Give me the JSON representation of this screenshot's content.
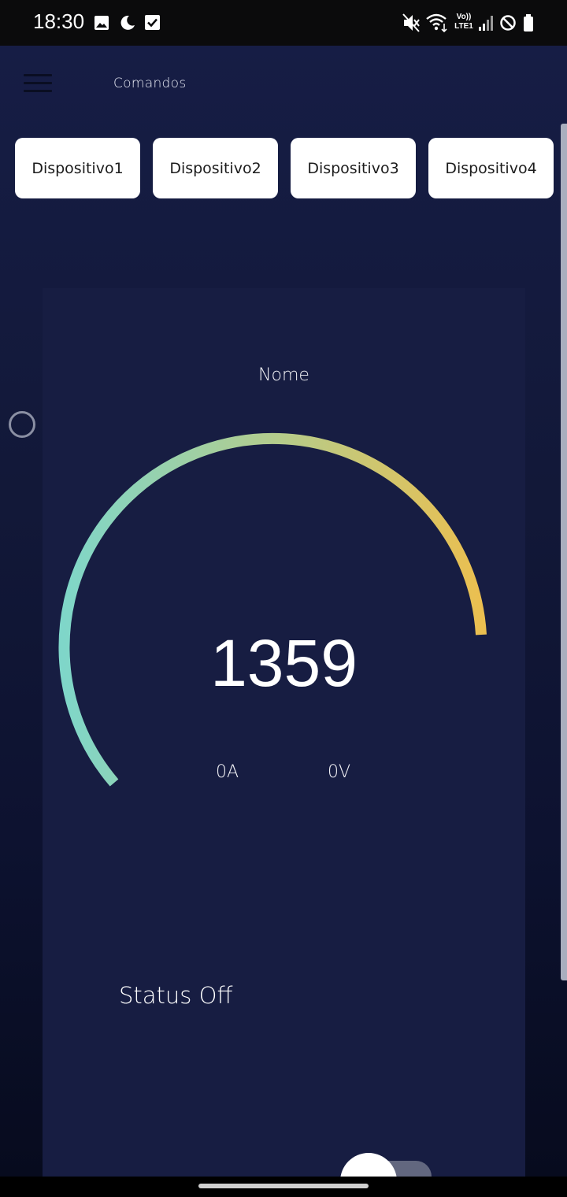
{
  "status_bar": {
    "time": "18:30",
    "left_icons": [
      "image-icon",
      "moon-icon",
      "checkbox-icon"
    ],
    "right_icons": [
      "mute-icon",
      "wifi-icon",
      "volte-icon",
      "signal-icon",
      "no-disturb-icon",
      "battery-icon"
    ],
    "volte_top": "Vo))",
    "volte_bottom": "LTE1"
  },
  "header": {
    "title": "Comandos",
    "menu_icon": "hamburger-icon"
  },
  "devices": [
    {
      "label": "Dispositivo1"
    },
    {
      "label": "Dispositivo2"
    },
    {
      "label": "Dispositivo3"
    },
    {
      "label": "Dispositivo4"
    }
  ],
  "card": {
    "name": "Nome",
    "value": "1359",
    "current": "0A",
    "voltage": "0V",
    "status": "Status Off",
    "toggle_on": false
  },
  "colors": {
    "background": "#121838",
    "card": "#171d42",
    "gauge_start": "#7fd6c9",
    "gauge_end": "#ebbf50"
  }
}
